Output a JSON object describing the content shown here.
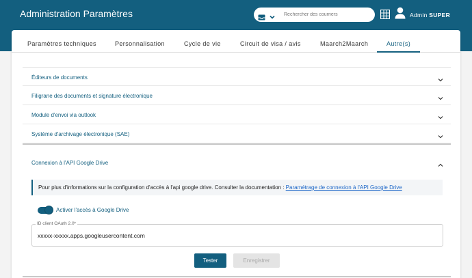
{
  "header": {
    "title": "Administration Paramètres",
    "search_placeholder": "Rechercher des courriers",
    "user_first": "Admin",
    "user_last": "SUPER"
  },
  "tabs": [
    {
      "label": "Paramètres techniques"
    },
    {
      "label": "Personnalisation"
    },
    {
      "label": "Cycle de vie"
    },
    {
      "label": "Circuit de visa / avis"
    },
    {
      "label": "Maarch2Maarch"
    },
    {
      "label": "Autre(s)",
      "active": true
    }
  ],
  "panels": [
    {
      "label": "Éditeurs de documents"
    },
    {
      "label": "Filigrane des documents et signature électronique"
    },
    {
      "label": "Module d'envoi via outlook"
    },
    {
      "label": "Système d'archivage électronique (SAE)"
    }
  ],
  "google_drive": {
    "title": "Connexion à l'API Google Drive",
    "info_text": "Pour plus d'informations sur la configuration d'accès à l'api google drive. Consulter la documentation : ",
    "info_link": "Paramétrage de connexion à l'API Google Drive",
    "toggle_label": "Activer l'accès à Google Drive",
    "toggle_on": true,
    "client_id_label": "ID client OAuth 2.0*",
    "client_id_value": "xxxxx-xxxxx.apps.googleusercontent.com",
    "test_button": "Tester",
    "save_button": "Enregistrer"
  },
  "colors": {
    "primary": "#135f7f",
    "link": "#1e68c8"
  }
}
